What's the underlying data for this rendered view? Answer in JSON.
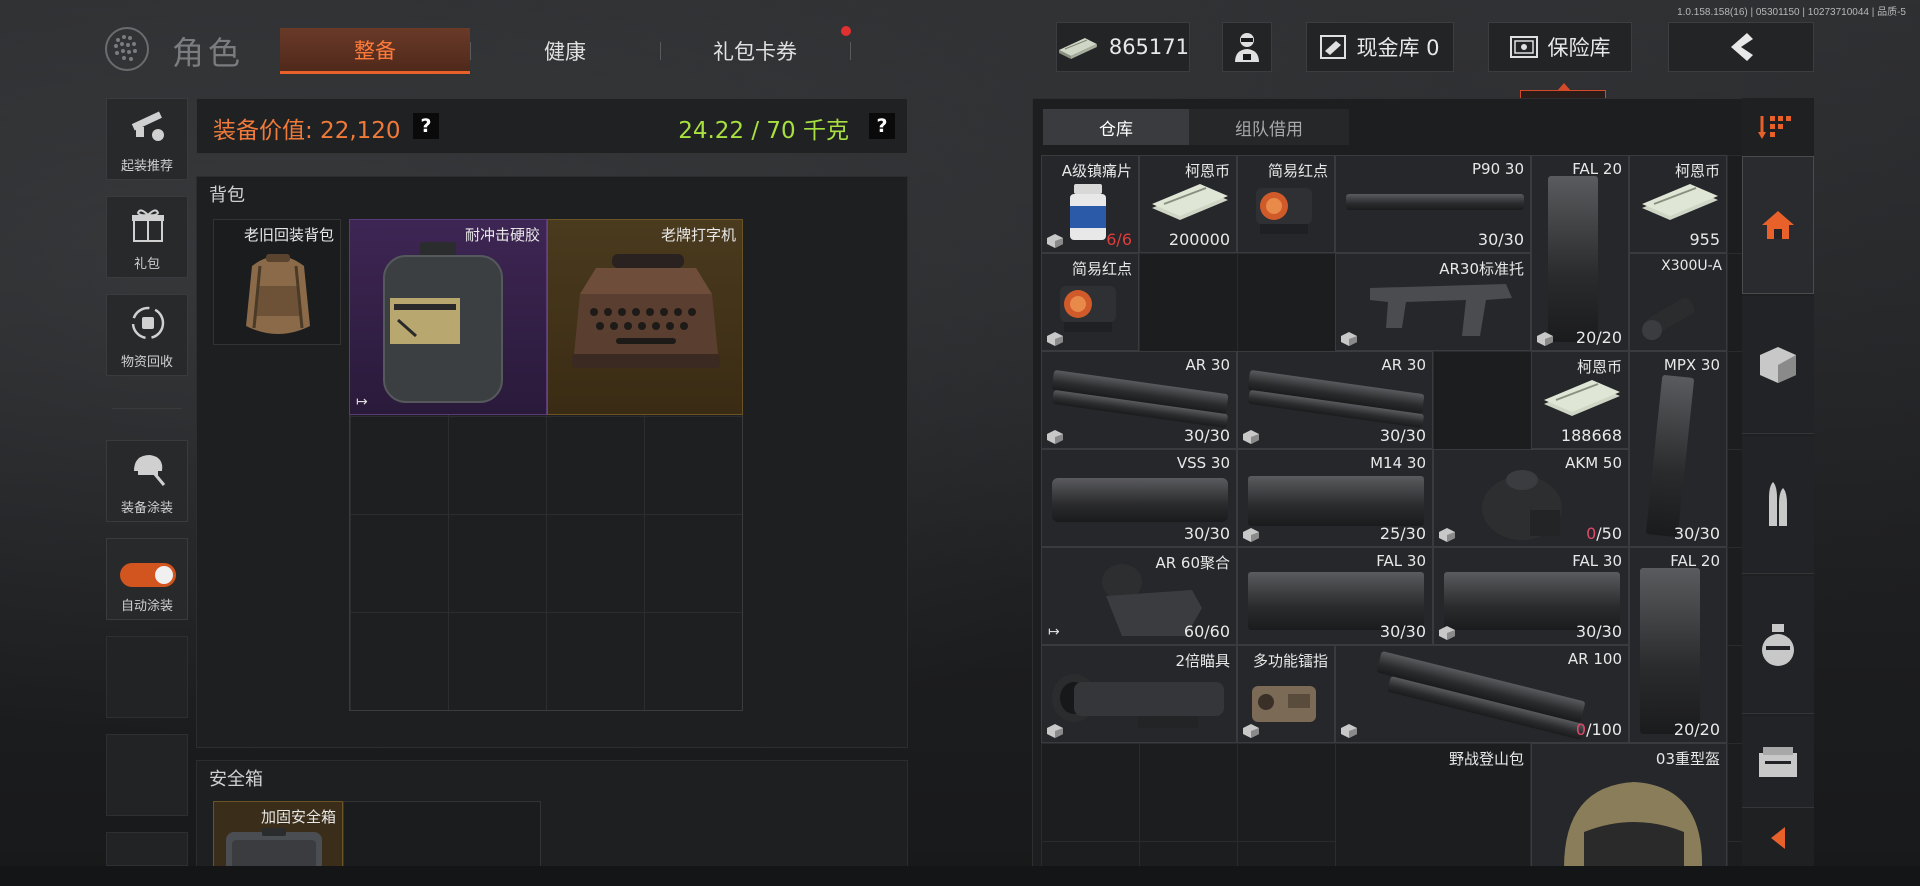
{
  "version": "1.0.158.158(16) | 05301150 | 10273710044 | 品质-5",
  "header": {
    "title": "角色",
    "tabs": [
      {
        "label": "整备",
        "active": true
      },
      {
        "label": "健康",
        "active": false
      },
      {
        "label": "礼包卡券",
        "active": false,
        "notification": true
      }
    ],
    "currency": "865171",
    "cash_vault": "现金库 0",
    "vault": "保险库",
    "vault_tooltip": "保险库"
  },
  "sidebar": [
    {
      "label": "起装推荐",
      "icon": "rifle-recommend-icon"
    },
    {
      "label": "礼包",
      "icon": "gift-icon"
    },
    {
      "label": "物资回收",
      "icon": "recycle-icon"
    },
    {
      "label": "装备涂装",
      "icon": "helmet-paint-icon"
    },
    {
      "label": "自动涂装",
      "icon": "toggle-icon",
      "toggle_on": true
    }
  ],
  "loadout": {
    "equip_value": "装备价值: 22,120",
    "weight": "24.22 / 70 千克",
    "help": "?",
    "backpack_label": "背包",
    "backpack_item": "老旧回装背包",
    "backpack_contents": [
      {
        "name": "耐冲击硬胶",
        "rarity": "purple"
      },
      {
        "name": "老牌打字机",
        "rarity": "gold"
      }
    ],
    "safe_label": "安全箱",
    "safe_item": "加固安全箱"
  },
  "stash": {
    "tabs": [
      {
        "label": "仓库",
        "active": true
      },
      {
        "label": "组队借用",
        "active": false
      }
    ],
    "items": [
      {
        "name": "A级镇痛片",
        "count_red": "6/6"
      },
      {
        "name": "柯恩币",
        "count": "200000"
      },
      {
        "name": "简易红点"
      },
      {
        "name": "P90 30",
        "count": "30/30"
      },
      {
        "name": "FAL 20"
      },
      {
        "name": "柯恩币",
        "count": "955"
      },
      {
        "name": "简易红点"
      },
      {
        "name": "AR30标准托"
      },
      {
        "name": "",
        "count": "20/20"
      },
      {
        "name": "X300U-A"
      },
      {
        "name": "AR 30",
        "count": "30/30"
      },
      {
        "name": "AR 30",
        "count": "30/30"
      },
      {
        "name": "柯恩币",
        "count": "188668"
      },
      {
        "name": "MPX 30",
        "count": "30/30"
      },
      {
        "name": "VSS 30",
        "count": "30/30"
      },
      {
        "name": "M14 30",
        "count": "25/30"
      },
      {
        "name": "AKM 50",
        "count_red": "0",
        "count_rest": "/50"
      },
      {
        "name": "AR 60聚合",
        "count": "60/60"
      },
      {
        "name": "FAL 30",
        "count": "30/30"
      },
      {
        "name": "FAL 30",
        "count": "30/30"
      },
      {
        "name": "FAL 20",
        "count": "20/20"
      },
      {
        "name": "2倍瞄具"
      },
      {
        "name": "多功能镭指"
      },
      {
        "name": "AR 100",
        "count_red": "0",
        "count_rest": "/100"
      },
      {
        "name": "野战登山包"
      },
      {
        "name": "03重型盔"
      }
    ]
  }
}
